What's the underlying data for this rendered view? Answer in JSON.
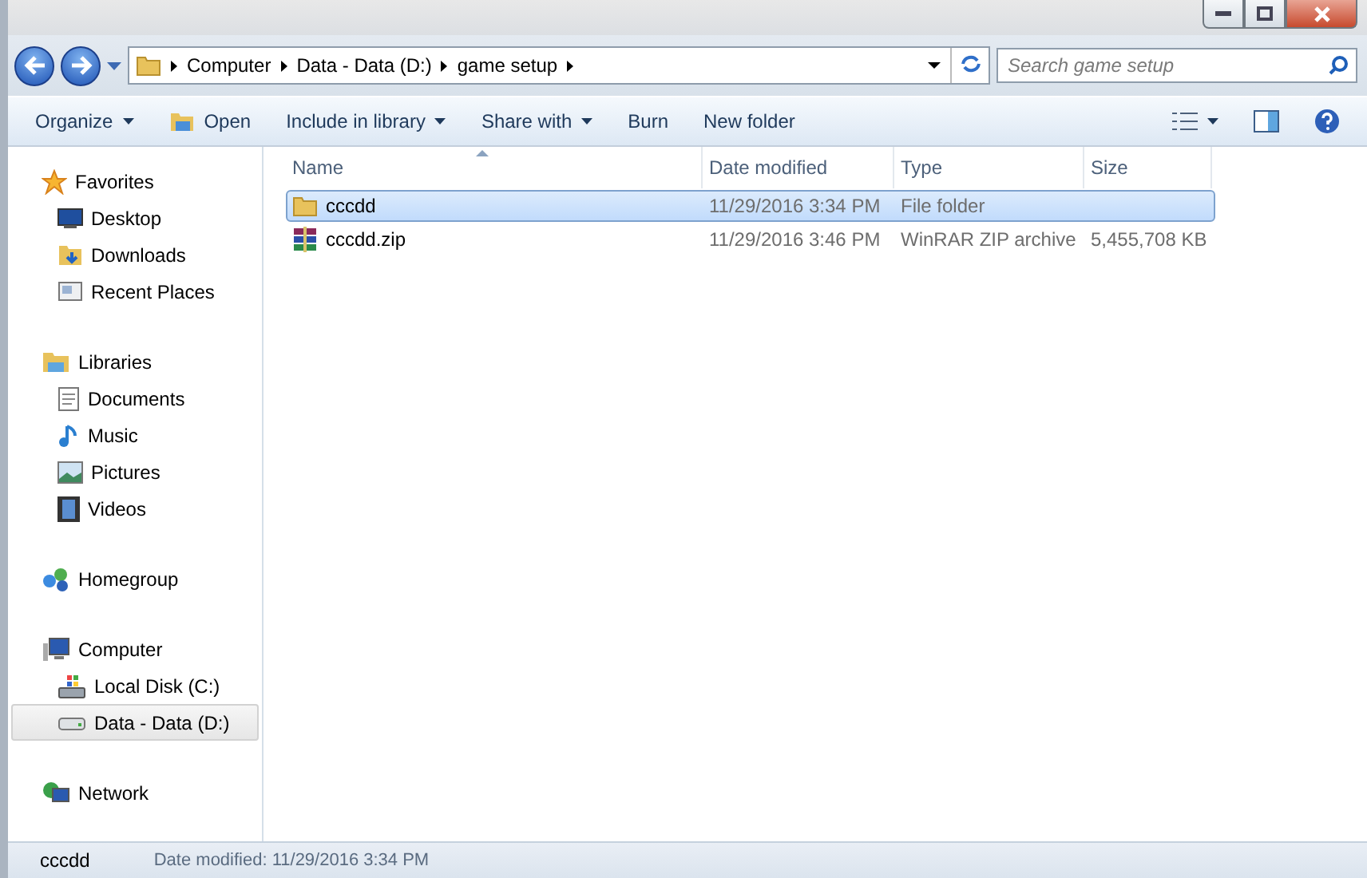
{
  "address_bar": {
    "crumbs": [
      "Computer",
      "Data - Data (D:)",
      "game setup"
    ]
  },
  "search": {
    "placeholder": "Search game setup"
  },
  "toolbar": {
    "buttons": [
      {
        "label": "Organize",
        "dropdown": true
      },
      {
        "label": "Open",
        "dropdown": false
      },
      {
        "label": "Include in library",
        "dropdown": true
      },
      {
        "label": "Share with",
        "dropdown": true
      },
      {
        "label": "Burn",
        "dropdown": false
      },
      {
        "label": "New folder",
        "dropdown": false
      }
    ]
  },
  "sidebar": {
    "groups": [
      {
        "label": "Favorites",
        "selected": false,
        "children": [
          {
            "label": "Desktop",
            "selected": false
          },
          {
            "label": "Downloads",
            "selected": false
          },
          {
            "label": "Recent Places",
            "selected": false
          }
        ]
      },
      {
        "label": "Libraries",
        "selected": false,
        "children": [
          {
            "label": "Documents",
            "selected": false
          },
          {
            "label": "Music",
            "selected": false
          },
          {
            "label": "Pictures",
            "selected": false
          },
          {
            "label": "Videos",
            "selected": false
          }
        ]
      },
      {
        "label": "Homegroup",
        "selected": false
      },
      {
        "label": "Computer",
        "selected": false,
        "children": [
          {
            "label": "Local Disk (C:)",
            "selected": false
          },
          {
            "label": "Data - Data (D:)",
            "selected": true
          }
        ]
      },
      {
        "label": "Network",
        "selected": false
      }
    ]
  },
  "table": {
    "columns": [
      "Name",
      "Date modified",
      "Type",
      "Size"
    ],
    "rows": [
      {
        "kind": "folder",
        "selected": true,
        "cells": [
          "cccdd",
          "11/29/2016 3:34 PM",
          "File folder",
          ""
        ]
      },
      {
        "kind": "archive",
        "selected": false,
        "cells": [
          "cccdd.zip",
          "11/29/2016 3:46 PM",
          "WinRAR ZIP archive",
          "5,455,708 KB"
        ]
      }
    ]
  },
  "details_pane": {
    "name": "cccdd",
    "info": "Date modified: 11/29/2016 3:34 PM"
  }
}
